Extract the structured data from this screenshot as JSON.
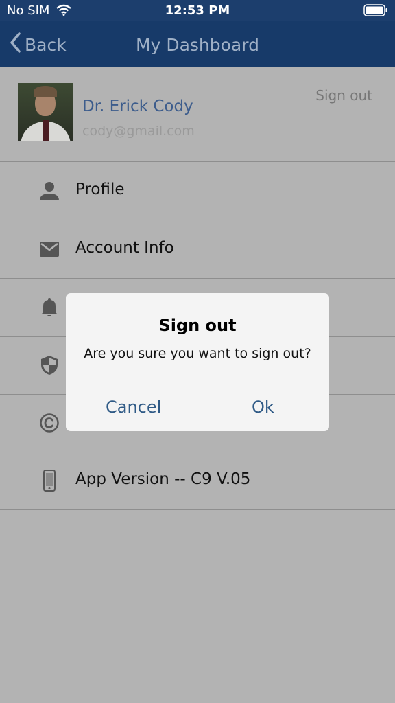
{
  "status_bar": {
    "carrier": "No SIM",
    "time": "12:53 PM"
  },
  "nav": {
    "back_label": "Back",
    "title": "My Dashboard"
  },
  "user": {
    "name": "Dr. Erick Cody",
    "email": "cody@gmail.com",
    "sign_out_label": "Sign out"
  },
  "menu": {
    "items": [
      {
        "label": "Profile",
        "icon": "person-icon"
      },
      {
        "label": "Account Info",
        "icon": "mail-icon"
      },
      {
        "label": "",
        "icon": "bell-icon"
      },
      {
        "label": "",
        "icon": "shield-icon"
      },
      {
        "label": "",
        "icon": "copyright-icon"
      },
      {
        "label": "App Version -- C9 V.05",
        "icon": "phone-icon"
      }
    ]
  },
  "dialog": {
    "title": "Sign out",
    "message": "Are you sure you want to sign out?",
    "cancel_label": "Cancel",
    "ok_label": "Ok"
  },
  "colors": {
    "nav_background": "#173a69",
    "dialog_button": "#2f5a86",
    "user_name": "#3c5c8c"
  }
}
